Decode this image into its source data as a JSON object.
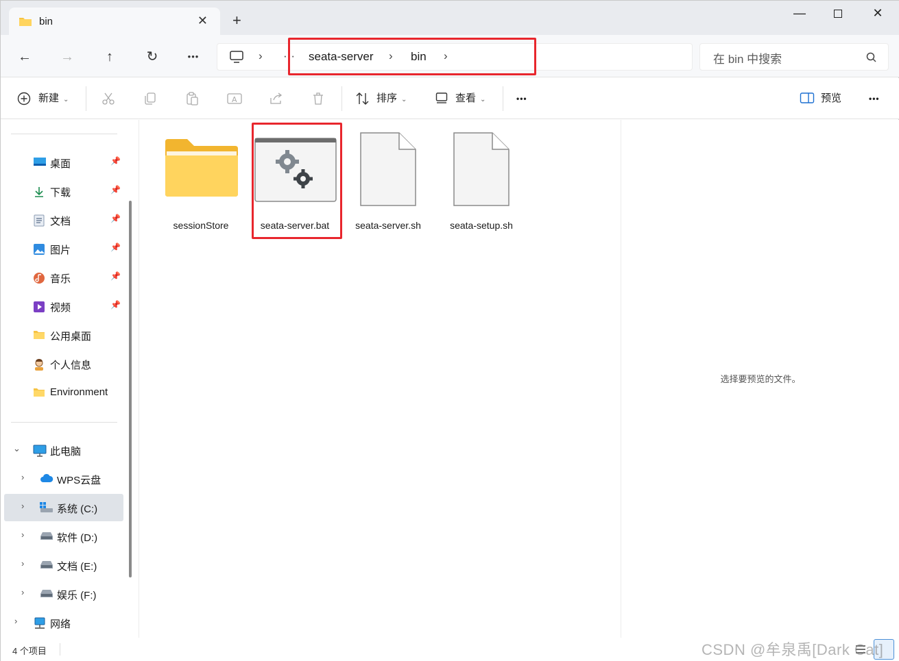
{
  "tab": {
    "title": "bin",
    "close": "✕",
    "new_tab": "+"
  },
  "window_controls": {
    "minimize": "—",
    "close": "✕"
  },
  "nav": {
    "back": "←",
    "forward": "→",
    "up": "↑",
    "refresh": "↻",
    "more": "•••"
  },
  "address": {
    "ellipsis": "···",
    "separator": "›",
    "crumbs": [
      "seata-server",
      "bin"
    ]
  },
  "search": {
    "placeholder": "在 bin 中搜索"
  },
  "toolbar": {
    "new": "新建",
    "sort": "排序",
    "view": "查看",
    "more": "•••",
    "preview": "预览",
    "overflow": "•••"
  },
  "sidebar": {
    "quick_access": [
      {
        "label": "桌面",
        "icon": "desktop-icon",
        "pinned": true
      },
      {
        "label": "下载",
        "icon": "download-icon",
        "pinned": true
      },
      {
        "label": "文档",
        "icon": "document-icon",
        "pinned": true
      },
      {
        "label": "图片",
        "icon": "picture-icon",
        "pinned": true
      },
      {
        "label": "音乐",
        "icon": "music-icon",
        "pinned": true
      },
      {
        "label": "视频",
        "icon": "video-icon",
        "pinned": true
      },
      {
        "label": "公用桌面",
        "icon": "folder-icon",
        "pinned": false
      },
      {
        "label": "个人信息",
        "icon": "user-icon",
        "pinned": false
      },
      {
        "label": "Environment",
        "icon": "folder-icon",
        "pinned": false
      }
    ],
    "this_pc": "此电脑",
    "drives": [
      {
        "label": "WPS云盘",
        "icon": "cloud-icon"
      },
      {
        "label": "系统 (C:)",
        "icon": "system-drive-icon",
        "selected": true
      },
      {
        "label": "软件 (D:)",
        "icon": "drive-icon"
      },
      {
        "label": "文档 (E:)",
        "icon": "drive-icon"
      },
      {
        "label": "娱乐 (F:)",
        "icon": "drive-icon"
      }
    ],
    "network": "网络",
    "expand_glyph": "›",
    "collapse_glyph": "⌄",
    "pin_glyph": "📌"
  },
  "files": [
    {
      "name": "sessionStore",
      "type": "folder"
    },
    {
      "name": "seata-server.bat",
      "type": "batch"
    },
    {
      "name": "seata-server.sh",
      "type": "file"
    },
    {
      "name": "seata-setup.sh",
      "type": "file"
    }
  ],
  "preview_pane": {
    "message": "选择要预览的文件。"
  },
  "status": {
    "count": "4 个项目",
    "watermark": "CSDN @牟泉禹[Dark Cat]"
  },
  "colors": {
    "highlight": "#e8262d",
    "folder": "#f6c343",
    "accent": "#1b6fd1"
  }
}
